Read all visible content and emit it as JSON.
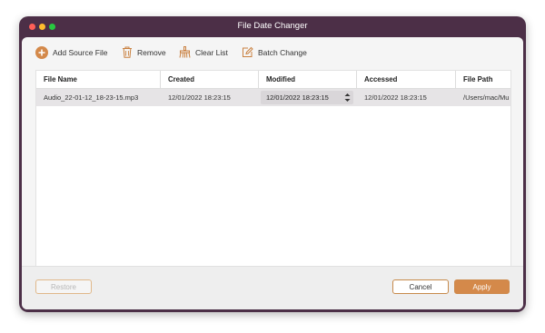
{
  "window": {
    "title": "File Date Changer"
  },
  "toolbar": {
    "add_source_file": "Add Source File",
    "remove": "Remove",
    "clear_list": "Clear List",
    "batch_change": "Batch Change"
  },
  "table": {
    "columns": [
      "File Name",
      "Created",
      "Modified",
      "Accessed",
      "File Path"
    ],
    "rows": [
      {
        "file_name": "Audio_22-01-12_18-23-15.mp3",
        "created": "12/01/2022 18:23:15",
        "modified": "12/01/2022 18:23:15",
        "accessed": "12/01/2022 18:23:15",
        "file_path": "/Users/mac/Mu"
      }
    ]
  },
  "buttons": {
    "restore": "Restore",
    "cancel": "Cancel",
    "apply": "Apply"
  },
  "colors": {
    "accent": "#d4894a",
    "window_frame": "#4c2f47",
    "selected_row": "#e6e4e6"
  },
  "icons": {
    "add_source_file": "plus-circle-icon",
    "remove": "trash-icon",
    "clear_list": "broom-icon",
    "batch_change": "edit-icon"
  }
}
